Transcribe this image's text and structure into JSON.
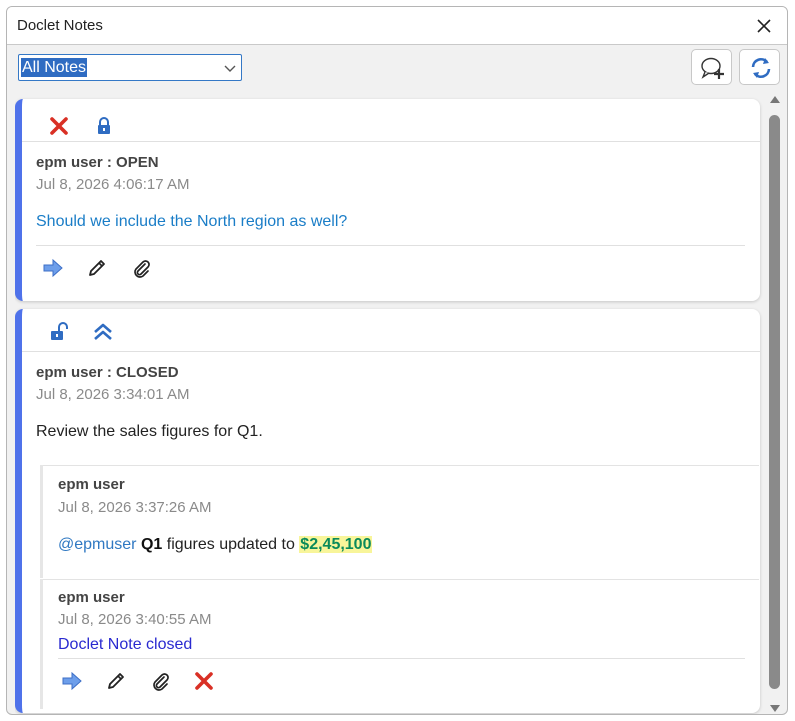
{
  "window": {
    "title": "Doclet Notes"
  },
  "toolbar": {
    "filter_selected": "All Notes",
    "add_note_icon": "add-comment-icon",
    "refresh_icon": "refresh-icon"
  },
  "notes": [
    {
      "author_status": "epm user : OPEN",
      "date": "Jul 8, 2026 4:06:17 AM",
      "message": "Should we include the North region as well?",
      "top_icons": [
        "delete-icon",
        "lock-icon"
      ],
      "action_icons": [
        "reply-arrow-icon",
        "edit-pencil-icon",
        "attachment-icon"
      ]
    },
    {
      "author_status": "epm user : CLOSED",
      "date": "Jul 8, 2026 3:34:01 AM",
      "message": "Review the sales figures for Q1.",
      "top_icons": [
        "unlock-icon",
        "collapse-chevron-icon"
      ],
      "replies": [
        {
          "author": "epm user",
          "date": "Jul 8, 2026 3:37:26 AM",
          "mention": "@epmuser",
          "bold": "Q1",
          "text": "figures updated to",
          "highlight": "$2,45,100"
        },
        {
          "author": "epm user",
          "date": "Jul 8, 2026 3:40:55 AM",
          "message": "Doclet Note closed"
        }
      ],
      "action_icons": [
        "reply-arrow-icon",
        "edit-pencil-icon",
        "attachment-icon",
        "delete-icon"
      ]
    }
  ],
  "colors": {
    "accent_bar": "#4f72ea",
    "link_blue": "#1a7dc7",
    "closed_blue": "#2a2ad0",
    "highlight_bg": "#f8f59a",
    "highlight_text": "#0a8a5a",
    "delete_red": "#d93025"
  }
}
